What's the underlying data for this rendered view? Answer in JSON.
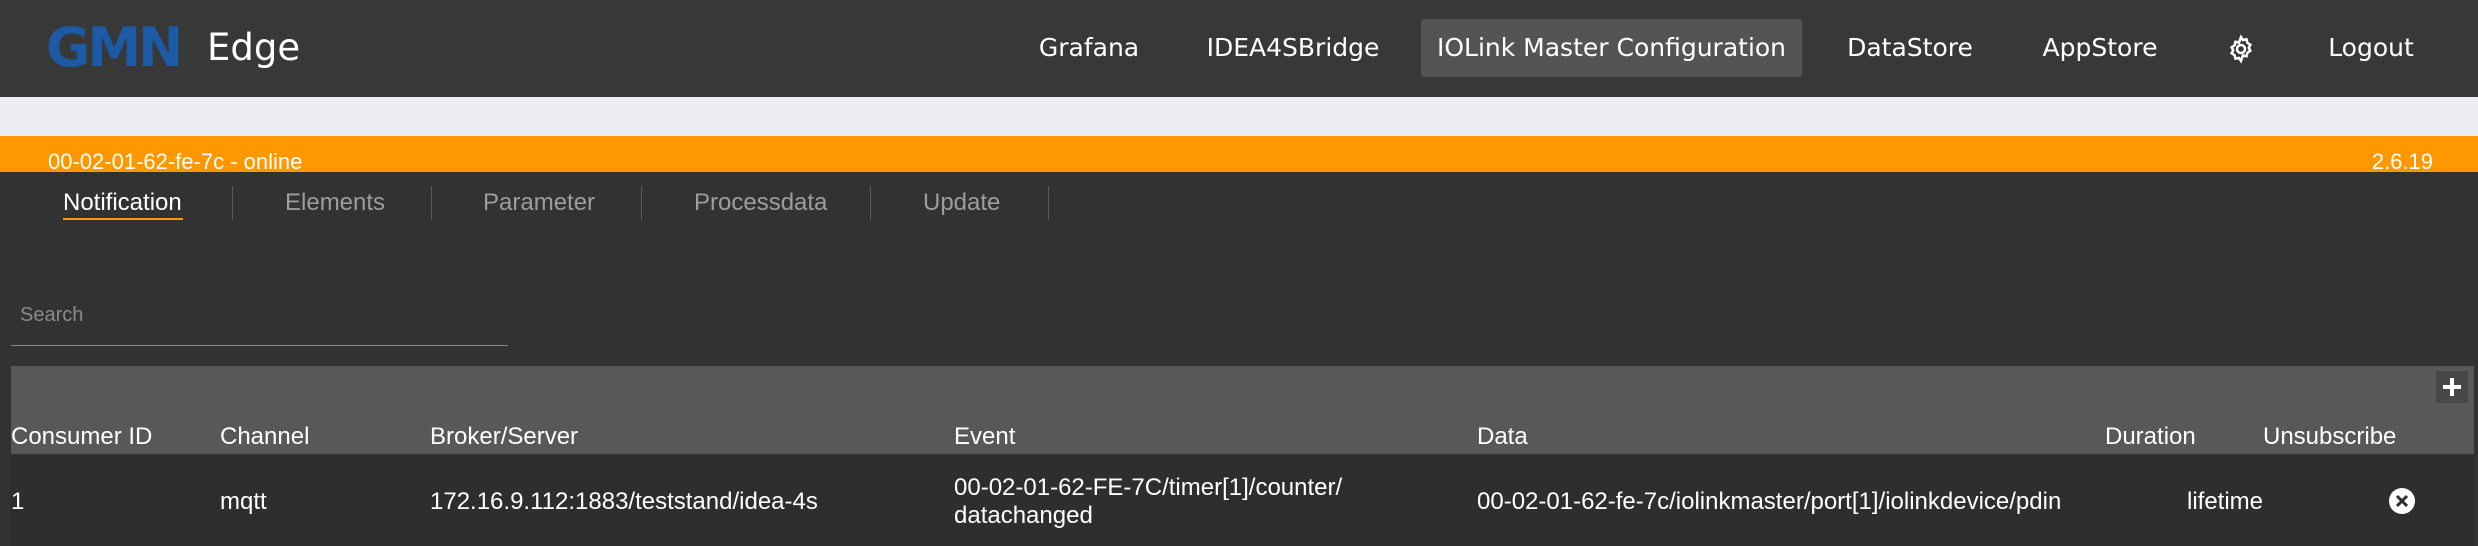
{
  "brand": {
    "logo_text": "GMN",
    "product_name": "Edge",
    "logo_color": "#1d5aa6"
  },
  "nav": {
    "items": [
      {
        "label": "Grafana",
        "active": false
      },
      {
        "label": "IDEA4SBridge",
        "active": false
      },
      {
        "label": "IOLink Master Configuration",
        "active": true
      },
      {
        "label": "DataStore",
        "active": false
      },
      {
        "label": "AppStore",
        "active": false
      },
      {
        "label": "Logout",
        "active": false
      }
    ],
    "settings_icon": "gear-icon"
  },
  "device": {
    "status_text": "00-02-01-62-fe-7c - online",
    "version": "2.6.19",
    "bar_color": "#ff9800"
  },
  "tabs": [
    {
      "label": "Notification",
      "active": true
    },
    {
      "label": "Elements",
      "active": false
    },
    {
      "label": "Parameter",
      "active": false
    },
    {
      "label": "Processdata",
      "active": false
    },
    {
      "label": "Update",
      "active": false
    }
  ],
  "search": {
    "placeholder": "Search",
    "value": ""
  },
  "table": {
    "add_icon": "plus-icon",
    "columns": [
      "Consumer ID",
      "Channel",
      "Broker/Server",
      "Event",
      "Data",
      "Duration",
      "Unsubscribe"
    ],
    "rows": [
      {
        "consumer_id": "1",
        "channel": "mqtt",
        "broker": "172.16.9.112:1883/teststand/idea-4s",
        "event": "00-02-01-62-FE-7C/timer[1]/counter/ datachanged",
        "data": "00-02-01-62-fe-7c/iolinkmaster/port[1]/iolinkdevice/pdin",
        "duration": "lifetime",
        "unsubscribe_icon": "close-icon"
      }
    ]
  }
}
